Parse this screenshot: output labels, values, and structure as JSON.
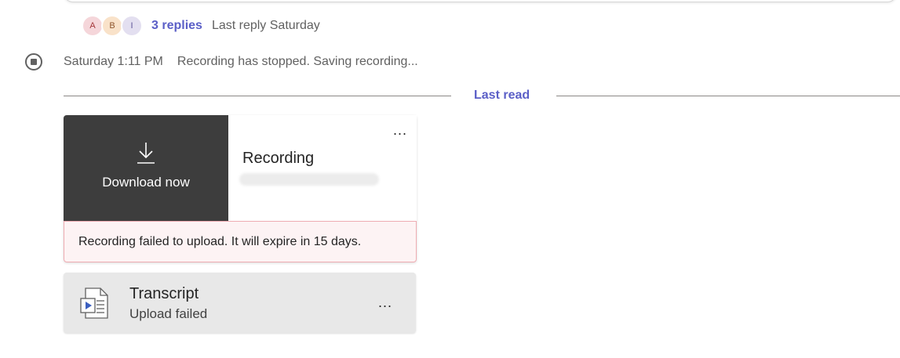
{
  "thread": {
    "avatars": [
      "A",
      "B",
      "I"
    ],
    "replies_label": "3 replies",
    "last_reply": "Last reply Saturday"
  },
  "status": {
    "time": "Saturday 1:11 PM",
    "message": "Recording has stopped. Saving recording..."
  },
  "divider": {
    "label": "Last read"
  },
  "recording_card": {
    "download_label": "Download now",
    "title": "Recording",
    "more_label": "...",
    "error_message": "Recording failed to upload. It will expire in 15 days."
  },
  "transcript_card": {
    "title": "Transcript",
    "subtitle": "Upload failed",
    "more_label": "..."
  },
  "colors": {
    "accent": "#5b5fc7",
    "recording_bg": "#3d3d3d",
    "error_bg": "#fdf3f4",
    "error_border": "#eeacb2",
    "transcript_bg": "#e8e8e8"
  }
}
